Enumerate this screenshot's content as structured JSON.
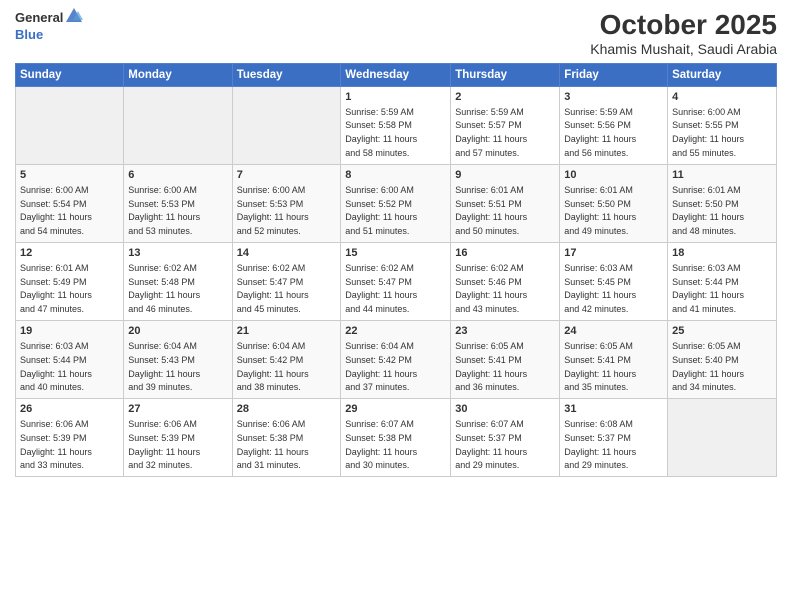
{
  "header": {
    "logo_general": "General",
    "logo_blue": "Blue",
    "month": "October 2025",
    "location": "Khamis Mushait, Saudi Arabia"
  },
  "days_of_week": [
    "Sunday",
    "Monday",
    "Tuesday",
    "Wednesday",
    "Thursday",
    "Friday",
    "Saturday"
  ],
  "weeks": [
    [
      {
        "day": "",
        "info": ""
      },
      {
        "day": "",
        "info": ""
      },
      {
        "day": "",
        "info": ""
      },
      {
        "day": "1",
        "info": "Sunrise: 5:59 AM\nSunset: 5:58 PM\nDaylight: 11 hours\nand 58 minutes."
      },
      {
        "day": "2",
        "info": "Sunrise: 5:59 AM\nSunset: 5:57 PM\nDaylight: 11 hours\nand 57 minutes."
      },
      {
        "day": "3",
        "info": "Sunrise: 5:59 AM\nSunset: 5:56 PM\nDaylight: 11 hours\nand 56 minutes."
      },
      {
        "day": "4",
        "info": "Sunrise: 6:00 AM\nSunset: 5:55 PM\nDaylight: 11 hours\nand 55 minutes."
      }
    ],
    [
      {
        "day": "5",
        "info": "Sunrise: 6:00 AM\nSunset: 5:54 PM\nDaylight: 11 hours\nand 54 minutes."
      },
      {
        "day": "6",
        "info": "Sunrise: 6:00 AM\nSunset: 5:53 PM\nDaylight: 11 hours\nand 53 minutes."
      },
      {
        "day": "7",
        "info": "Sunrise: 6:00 AM\nSunset: 5:53 PM\nDaylight: 11 hours\nand 52 minutes."
      },
      {
        "day": "8",
        "info": "Sunrise: 6:00 AM\nSunset: 5:52 PM\nDaylight: 11 hours\nand 51 minutes."
      },
      {
        "day": "9",
        "info": "Sunrise: 6:01 AM\nSunset: 5:51 PM\nDaylight: 11 hours\nand 50 minutes."
      },
      {
        "day": "10",
        "info": "Sunrise: 6:01 AM\nSunset: 5:50 PM\nDaylight: 11 hours\nand 49 minutes."
      },
      {
        "day": "11",
        "info": "Sunrise: 6:01 AM\nSunset: 5:50 PM\nDaylight: 11 hours\nand 48 minutes."
      }
    ],
    [
      {
        "day": "12",
        "info": "Sunrise: 6:01 AM\nSunset: 5:49 PM\nDaylight: 11 hours\nand 47 minutes."
      },
      {
        "day": "13",
        "info": "Sunrise: 6:02 AM\nSunset: 5:48 PM\nDaylight: 11 hours\nand 46 minutes."
      },
      {
        "day": "14",
        "info": "Sunrise: 6:02 AM\nSunset: 5:47 PM\nDaylight: 11 hours\nand 45 minutes."
      },
      {
        "day": "15",
        "info": "Sunrise: 6:02 AM\nSunset: 5:47 PM\nDaylight: 11 hours\nand 44 minutes."
      },
      {
        "day": "16",
        "info": "Sunrise: 6:02 AM\nSunset: 5:46 PM\nDaylight: 11 hours\nand 43 minutes."
      },
      {
        "day": "17",
        "info": "Sunrise: 6:03 AM\nSunset: 5:45 PM\nDaylight: 11 hours\nand 42 minutes."
      },
      {
        "day": "18",
        "info": "Sunrise: 6:03 AM\nSunset: 5:44 PM\nDaylight: 11 hours\nand 41 minutes."
      }
    ],
    [
      {
        "day": "19",
        "info": "Sunrise: 6:03 AM\nSunset: 5:44 PM\nDaylight: 11 hours\nand 40 minutes."
      },
      {
        "day": "20",
        "info": "Sunrise: 6:04 AM\nSunset: 5:43 PM\nDaylight: 11 hours\nand 39 minutes."
      },
      {
        "day": "21",
        "info": "Sunrise: 6:04 AM\nSunset: 5:42 PM\nDaylight: 11 hours\nand 38 minutes."
      },
      {
        "day": "22",
        "info": "Sunrise: 6:04 AM\nSunset: 5:42 PM\nDaylight: 11 hours\nand 37 minutes."
      },
      {
        "day": "23",
        "info": "Sunrise: 6:05 AM\nSunset: 5:41 PM\nDaylight: 11 hours\nand 36 minutes."
      },
      {
        "day": "24",
        "info": "Sunrise: 6:05 AM\nSunset: 5:41 PM\nDaylight: 11 hours\nand 35 minutes."
      },
      {
        "day": "25",
        "info": "Sunrise: 6:05 AM\nSunset: 5:40 PM\nDaylight: 11 hours\nand 34 minutes."
      }
    ],
    [
      {
        "day": "26",
        "info": "Sunrise: 6:06 AM\nSunset: 5:39 PM\nDaylight: 11 hours\nand 33 minutes."
      },
      {
        "day": "27",
        "info": "Sunrise: 6:06 AM\nSunset: 5:39 PM\nDaylight: 11 hours\nand 32 minutes."
      },
      {
        "day": "28",
        "info": "Sunrise: 6:06 AM\nSunset: 5:38 PM\nDaylight: 11 hours\nand 31 minutes."
      },
      {
        "day": "29",
        "info": "Sunrise: 6:07 AM\nSunset: 5:38 PM\nDaylight: 11 hours\nand 30 minutes."
      },
      {
        "day": "30",
        "info": "Sunrise: 6:07 AM\nSunset: 5:37 PM\nDaylight: 11 hours\nand 29 minutes."
      },
      {
        "day": "31",
        "info": "Sunrise: 6:08 AM\nSunset: 5:37 PM\nDaylight: 11 hours\nand 29 minutes."
      },
      {
        "day": "",
        "info": ""
      }
    ]
  ],
  "row_colors": [
    "white",
    "gray",
    "white",
    "gray",
    "white"
  ]
}
